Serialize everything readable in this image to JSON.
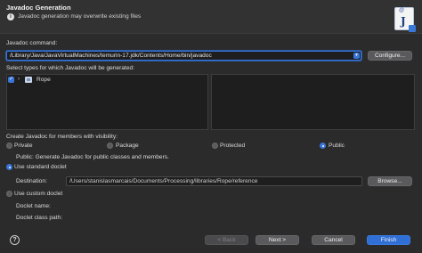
{
  "window": {
    "title": "Javadoc Generation",
    "warning": "Javadoc generation may overwrite existing files"
  },
  "command": {
    "label": "Javadoc command:",
    "value": "/Library/Java/JavaVirtualMachines/temurin-17.jdk/Contents/Home/bin/javadoc",
    "configure_label": "Configure..."
  },
  "types": {
    "label": "Select types for which Javadoc will be generated:",
    "items": [
      {
        "label": "Rope",
        "checked": true
      }
    ]
  },
  "visibility": {
    "label": "Create Javadoc for members with visibility:",
    "options": [
      "Private",
      "Package",
      "Protected",
      "Public"
    ],
    "selected": "Public",
    "description": "Public: Generate Javadoc for public classes and members."
  },
  "doclet": {
    "standard_label": "Use standard doclet",
    "destination_label": "Destination:",
    "destination_value": "/Users/stanislasmarcais/Documents/Processing/libraries/Rope/reference",
    "browse_label": "Browse...",
    "custom_label": "Use custom doclet",
    "name_label": "Doclet name:",
    "classpath_label": "Doclet class path:"
  },
  "footer": {
    "help_icon": "?",
    "back_label": "< Back",
    "next_label": "Next >",
    "cancel_label": "Cancel",
    "finish_label": "Finish"
  }
}
